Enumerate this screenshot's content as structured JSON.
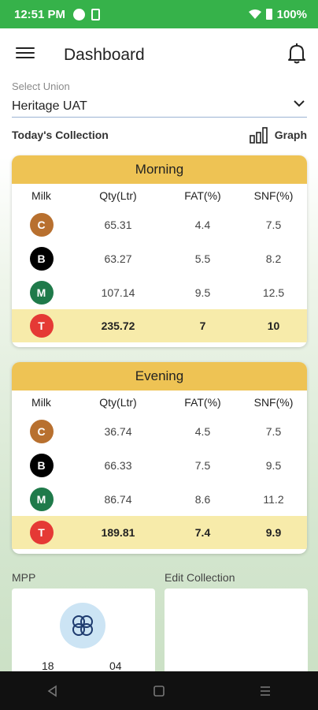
{
  "status": {
    "time": "12:51 PM",
    "battery": "100%"
  },
  "header": {
    "title": "Dashboard"
  },
  "union": {
    "label": "Select Union",
    "value": "Heritage UAT"
  },
  "collection": {
    "title": "Today's Collection",
    "graph_label": "Graph"
  },
  "columns": [
    "Milk",
    "Qty(Ltr)",
    "FAT(%)",
    "SNF(%)"
  ],
  "morning": {
    "title": "Morning",
    "rows": [
      {
        "code": "C",
        "qty": "65.31",
        "fat": "4.4",
        "snf": "7.5",
        "color": "#b8702f"
      },
      {
        "code": "B",
        "qty": "63.27",
        "fat": "5.5",
        "snf": "8.2",
        "color": "#000000"
      },
      {
        "code": "M",
        "qty": "107.14",
        "fat": "9.5",
        "snf": "12.5",
        "color": "#1f7a4a"
      }
    ],
    "total": {
      "code": "T",
      "qty": "235.72",
      "fat": "7",
      "snf": "10",
      "color": "#e53935"
    }
  },
  "evening": {
    "title": "Evening",
    "rows": [
      {
        "code": "C",
        "qty": "36.74",
        "fat": "4.5",
        "snf": "7.5",
        "color": "#b8702f"
      },
      {
        "code": "B",
        "qty": "66.33",
        "fat": "7.5",
        "snf": "9.5",
        "color": "#000000"
      },
      {
        "code": "M",
        "qty": "86.74",
        "fat": "8.6",
        "snf": "11.2",
        "color": "#1f7a4a"
      }
    ],
    "total": {
      "code": "T",
      "qty": "189.81",
      "fat": "7.4",
      "snf": "9.9",
      "color": "#e53935"
    }
  },
  "bottom": {
    "mpp_label": "MPP",
    "edit_label": "Edit Collection",
    "mpp_left": "18",
    "mpp_right": "04"
  }
}
